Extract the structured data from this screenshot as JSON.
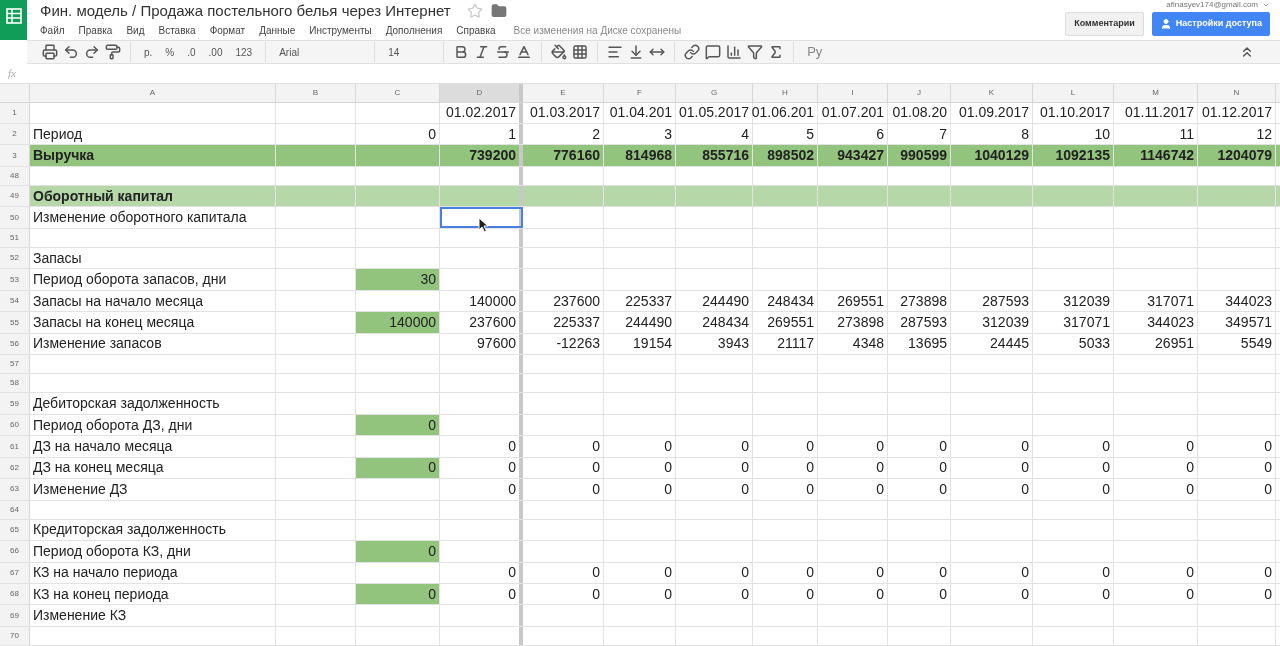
{
  "header": {
    "title": "Фин. модель / Продажа постельного белья через Интернет",
    "account": "afinasyev174@gmail.com",
    "save_status": "Все изменения на Диске сохранены",
    "buttons": [
      {
        "label": "Комментарии",
        "kind": "plain"
      },
      {
        "label": "Настройки доступа",
        "kind": "primary"
      }
    ]
  },
  "menu": [
    "Файл",
    "Правка",
    "Вид",
    "Вставка",
    "Формат",
    "Данные",
    "Инструменты",
    "Дополнения",
    "Справка"
  ],
  "toolbar": {
    "currency": "р.",
    "percent": "%",
    "decrease_decimals": ".0",
    "increase_decimals": ".00",
    "format": "123",
    "font": "Arial",
    "font_size": "14",
    "input_tools": "Ру"
  },
  "formula_bar": {
    "label": "fx"
  },
  "columns": [
    {
      "letter": "A",
      "selected": false
    },
    {
      "letter": "B",
      "selected": false
    },
    {
      "letter": "C",
      "selected": false
    },
    {
      "letter": "D",
      "selected": true
    },
    {
      "letter": "E",
      "selected": false
    },
    {
      "letter": "F",
      "selected": false
    },
    {
      "letter": "G",
      "selected": false
    },
    {
      "letter": "H",
      "selected": false
    },
    {
      "letter": "I",
      "selected": false
    },
    {
      "letter": "J",
      "selected": false
    },
    {
      "letter": "K",
      "selected": false
    },
    {
      "letter": "L",
      "selected": false
    },
    {
      "letter": "M",
      "selected": false
    },
    {
      "letter": "N",
      "selected": false
    }
  ],
  "rows": [
    {
      "number": "1",
      "kind": "plain",
      "d_selected": false,
      "values": [
        "01.02.2017",
        "01.03.2017",
        "01.04.201",
        "01.05.2017",
        "01.06.201",
        "01.07.201",
        "01.08.20",
        "01.09.2017",
        "01.10.2017",
        "01.11.2017",
        "01.12.2017"
      ]
    },
    {
      "number": "2",
      "kind": "plain",
      "d_selected": false,
      "label": "Период",
      "c": {
        "value": "0",
        "highlighted": false
      },
      "values": [
        "1",
        "2",
        "3",
        "4",
        "5",
        "6",
        "7",
        "8",
        "10",
        "11",
        "12"
      ]
    },
    {
      "number": "3",
      "kind": "total",
      "d_selected": false,
      "label": "Выручка",
      "values": [
        "739200",
        "776160",
        "814968",
        "855716",
        "898502",
        "943427",
        "990599",
        "1040129",
        "1092135",
        "1146742",
        "1204079"
      ]
    },
    {
      "number": "48",
      "kind": "plain",
      "d_selected": false
    },
    {
      "number": "49",
      "kind": "section",
      "d_selected": false,
      "label": "Оборотный капитал"
    },
    {
      "number": "50",
      "kind": "plain",
      "d_selected": true,
      "label": "Изменение оборотного капитала"
    },
    {
      "number": "51",
      "kind": "plain",
      "d_selected": false
    },
    {
      "number": "52",
      "kind": "plain",
      "d_selected": false,
      "label": "Запасы"
    },
    {
      "number": "53",
      "kind": "plain",
      "d_selected": false,
      "label": "Период оборота запасов, дни",
      "c": {
        "value": "30",
        "highlighted": true
      }
    },
    {
      "number": "54",
      "kind": "plain",
      "d_selected": false,
      "label": "Запасы на начало месяца",
      "values": [
        "140000",
        "237600",
        "225337",
        "244490",
        "248434",
        "269551",
        "273898",
        "287593",
        "312039",
        "317071",
        "344023"
      ]
    },
    {
      "number": "55",
      "kind": "plain",
      "d_selected": false,
      "label": "Запасы на конец месяца",
      "c": {
        "value": "140000",
        "highlighted": true
      },
      "values": [
        "237600",
        "225337",
        "244490",
        "248434",
        "269551",
        "273898",
        "287593",
        "312039",
        "317071",
        "344023",
        "349571"
      ]
    },
    {
      "number": "56",
      "kind": "plain",
      "d_selected": false,
      "label": "Изменение запасов",
      "values": [
        "97600",
        "-12263",
        "19154",
        "3943",
        "21117",
        "4348",
        "13695",
        "24445",
        "5033",
        "26951",
        "5549"
      ]
    },
    {
      "number": "57",
      "kind": "plain",
      "d_selected": false
    },
    {
      "number": "58",
      "kind": "plain",
      "d_selected": false
    },
    {
      "number": "59",
      "kind": "plain",
      "d_selected": false,
      "label": "Дебиторская задолженность"
    },
    {
      "number": "60",
      "kind": "plain",
      "d_selected": false,
      "label": "Период оборота ДЗ, дни",
      "c": {
        "value": "0",
        "highlighted": true
      }
    },
    {
      "number": "61",
      "kind": "plain",
      "d_selected": false,
      "label": "ДЗ на начало месяца",
      "values": [
        "0",
        "0",
        "0",
        "0",
        "0",
        "0",
        "0",
        "0",
        "0",
        "0",
        "0"
      ]
    },
    {
      "number": "62",
      "kind": "plain",
      "d_selected": false,
      "label": "ДЗ на конец месяца",
      "c": {
        "value": "0",
        "highlighted": true
      },
      "values": [
        "0",
        "0",
        "0",
        "0",
        "0",
        "0",
        "0",
        "0",
        "0",
        "0",
        "0"
      ]
    },
    {
      "number": "63",
      "kind": "plain",
      "d_selected": false,
      "label": "Изменение ДЗ",
      "values": [
        "0",
        "0",
        "0",
        "0",
        "0",
        "0",
        "0",
        "0",
        "0",
        "0",
        "0"
      ]
    },
    {
      "number": "64",
      "kind": "plain",
      "d_selected": false
    },
    {
      "number": "65",
      "kind": "plain",
      "d_selected": false,
      "label": "Кредиторская задолженность"
    },
    {
      "number": "66",
      "kind": "plain",
      "d_selected": false,
      "label": "Период оборота КЗ, дни",
      "c": {
        "value": "0",
        "highlighted": true
      }
    },
    {
      "number": "67",
      "kind": "plain",
      "d_selected": false,
      "label": "КЗ на начало периода",
      "values": [
        "0",
        "0",
        "0",
        "0",
        "0",
        "0",
        "0",
        "0",
        "0",
        "0",
        "0"
      ]
    },
    {
      "number": "68",
      "kind": "plain",
      "d_selected": false,
      "label": "КЗ на конец периода",
      "c": {
        "value": "0",
        "highlighted": true
      },
      "values": [
        "0",
        "0",
        "0",
        "0",
        "0",
        "0",
        "0",
        "0",
        "0",
        "0",
        "0"
      ]
    },
    {
      "number": "69",
      "kind": "plain",
      "d_selected": false,
      "label": "Изменение КЗ"
    },
    {
      "number": "70",
      "kind": "plain",
      "d_selected": false
    }
  ]
}
